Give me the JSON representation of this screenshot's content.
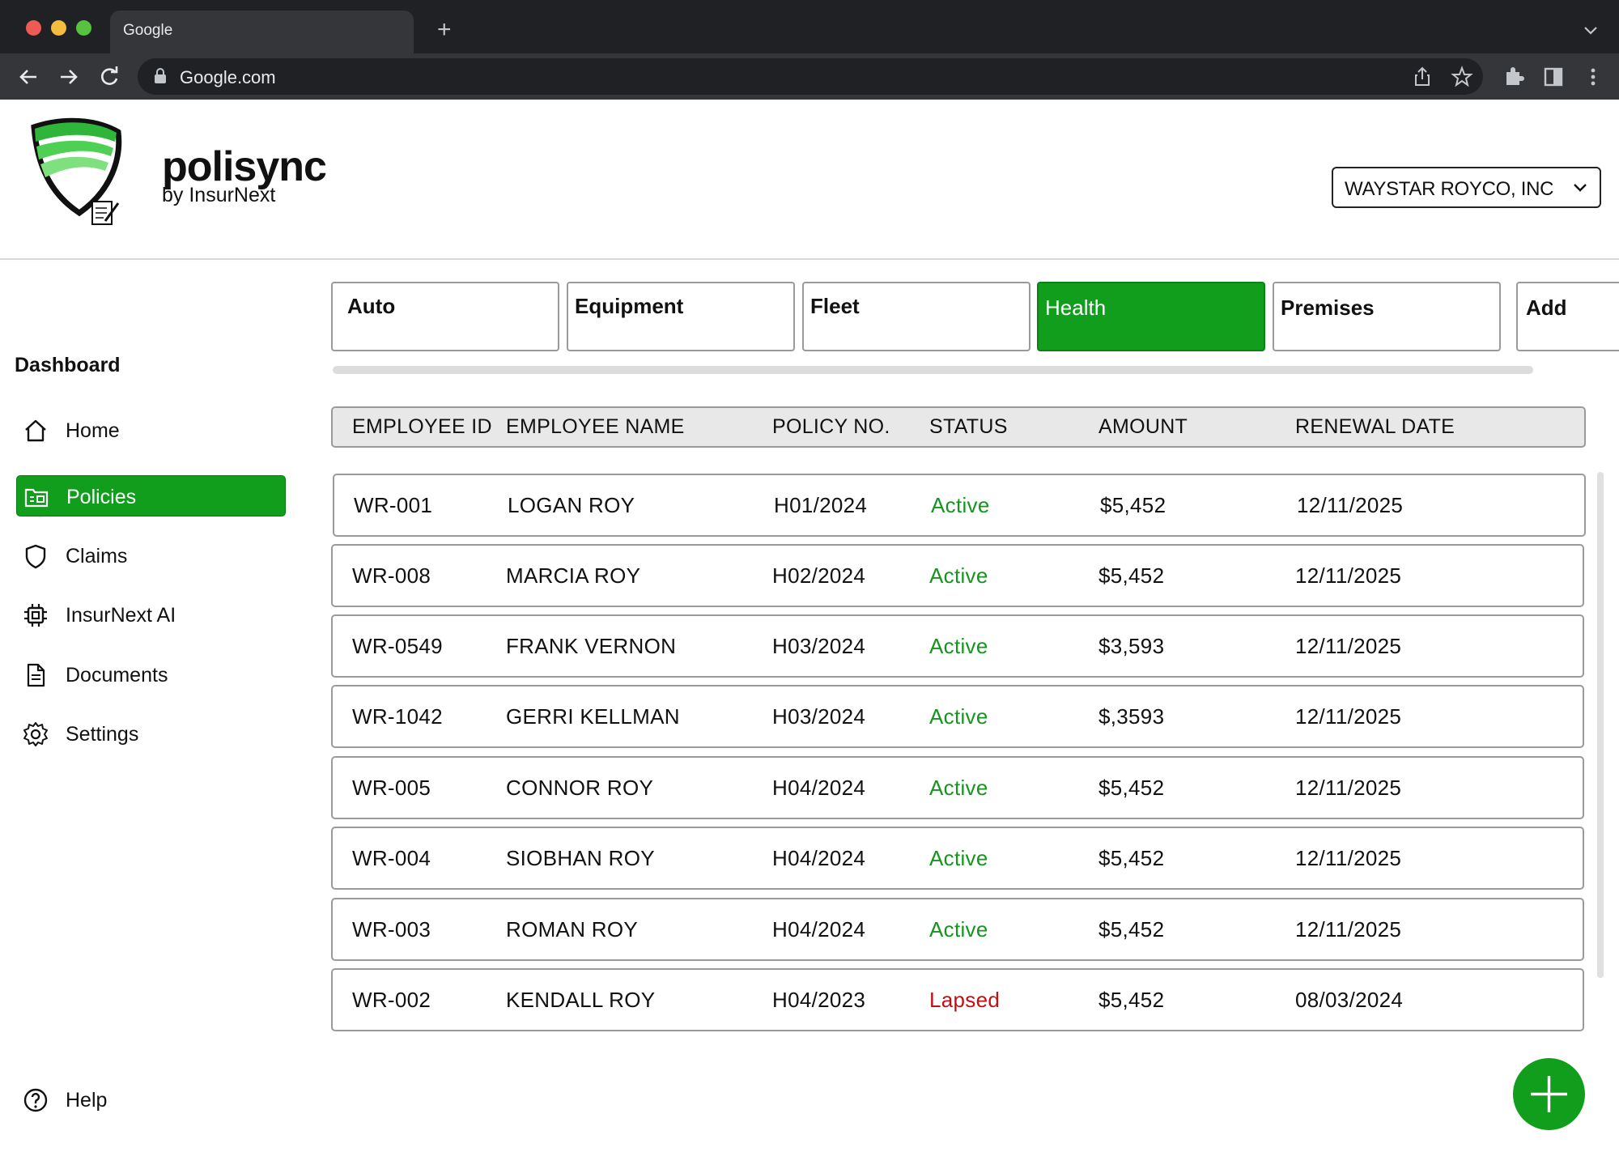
{
  "browser": {
    "tab_title": "Google",
    "url": "Google.com"
  },
  "brand": {
    "name": "polisync",
    "subtitle": "by InsurNext",
    "accent_color": "#119e1c"
  },
  "company_selector": {
    "value": "WAYSTAR ROYCO, INC"
  },
  "sidebar": {
    "title": "Dashboard",
    "items": [
      {
        "label": "Home",
        "icon": "home-icon"
      },
      {
        "label": "Policies",
        "icon": "folder-icon",
        "active": true
      },
      {
        "label": "Claims",
        "icon": "shield-icon"
      },
      {
        "label": "InsurNext AI",
        "icon": "chip-icon"
      },
      {
        "label": "Documents",
        "icon": "document-icon"
      },
      {
        "label": "Settings",
        "icon": "gear-icon"
      }
    ],
    "help_label": "Help"
  },
  "categories": [
    {
      "label": "Auto"
    },
    {
      "label": "Equipment"
    },
    {
      "label": "Fleet"
    },
    {
      "label": "Health",
      "selected": true
    },
    {
      "label": "Premises"
    },
    {
      "label": "Add"
    }
  ],
  "table": {
    "headers": [
      "EMPLOYEE ID",
      "EMPLOYEE NAME",
      "POLICY NO.",
      "STATUS",
      "AMOUNT",
      "RENEWAL DATE"
    ],
    "rows": [
      [
        "WR-001",
        "LOGAN ROY",
        "H01/2024",
        "Active",
        "$5,452",
        "12/11/2025"
      ],
      [
        "WR-008",
        "MARCIA ROY",
        "H02/2024",
        "Active",
        "$5,452",
        "12/11/2025"
      ],
      [
        "WR-0549",
        "FRANK VERNON",
        "H03/2024",
        "Active",
        "$3,593",
        "12/11/2025"
      ],
      [
        "WR-1042",
        "GERRI KELLMAN",
        "H03/2024",
        "Active",
        "$,3593",
        "12/11/2025"
      ],
      [
        "WR-005",
        "CONNOR ROY",
        "H04/2024",
        "Active",
        "$5,452",
        "12/11/2025"
      ],
      [
        "WR-004",
        "SIOBHAN ROY",
        "H04/2024",
        "Active",
        "$5,452",
        "12/11/2025"
      ],
      [
        "WR-003",
        "ROMAN ROY",
        "H04/2024",
        "Active",
        "$5,452",
        "12/11/2025"
      ],
      [
        "WR-002",
        "KENDALL ROY",
        "H04/2023",
        "Lapsed",
        "$5,452",
        "08/03/2024"
      ]
    ],
    "status_colors": {
      "Active": "#14961e",
      "Lapsed": "#c40f12"
    }
  },
  "fab": {
    "icon": "plus-icon"
  }
}
